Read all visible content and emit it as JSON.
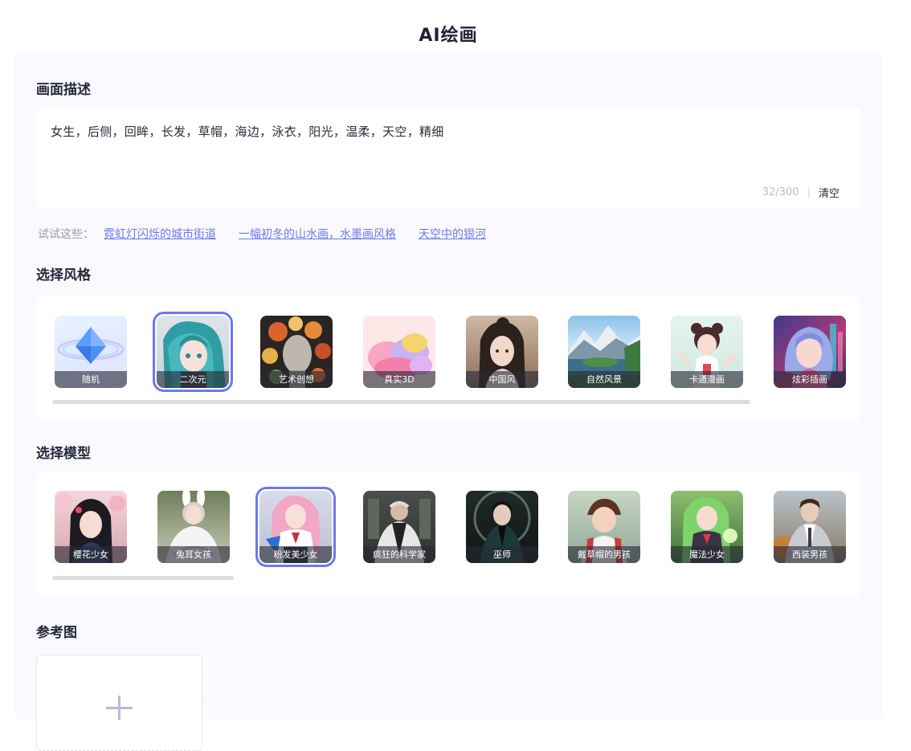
{
  "title": "AI绘画",
  "description": {
    "section_title": "画面描述",
    "value": "女生，后侧，回眸，长发，草帽，海边，泳衣，阳光，温柔，天空，精细",
    "char_count": "32/300",
    "divider": "|",
    "clear_label": "清空"
  },
  "tips": {
    "label": "试试这些：",
    "items": [
      "霓虹灯闪烁的城市街道",
      "一幅初冬的山水画，水墨画风格",
      "天空中的银河"
    ]
  },
  "styles": {
    "section_title": "选择风格",
    "selected_index": 1,
    "items": [
      {
        "label": "随机",
        "icon": "diamond-icon"
      },
      {
        "label": "二次元",
        "icon": "anime-girl"
      },
      {
        "label": "艺术创想",
        "icon": "art-sculpture"
      },
      {
        "label": "真实3D",
        "icon": "yarn-3d"
      },
      {
        "label": "中国风",
        "icon": "chinese-portrait"
      },
      {
        "label": "自然风景",
        "icon": "mountain-lake"
      },
      {
        "label": "卡通漫画",
        "icon": "cartoon-girl"
      },
      {
        "label": "炫彩插画",
        "icon": "colorful-girl"
      }
    ]
  },
  "models": {
    "section_title": "选择模型",
    "selected_index": 2,
    "items": [
      {
        "label": "樱花少女"
      },
      {
        "label": "兔耳女孩"
      },
      {
        "label": "粉发美少女"
      },
      {
        "label": "疯狂的科学家"
      },
      {
        "label": "巫师"
      },
      {
        "label": "戴草帽的男孩"
      },
      {
        "label": "魔法少女"
      },
      {
        "label": "西装男孩"
      }
    ]
  },
  "reference": {
    "section_title": "参考图"
  },
  "colors": {
    "accent": "#6b78f2",
    "link": "#6f7ae6",
    "panel_bg": "#f9f9fe"
  }
}
